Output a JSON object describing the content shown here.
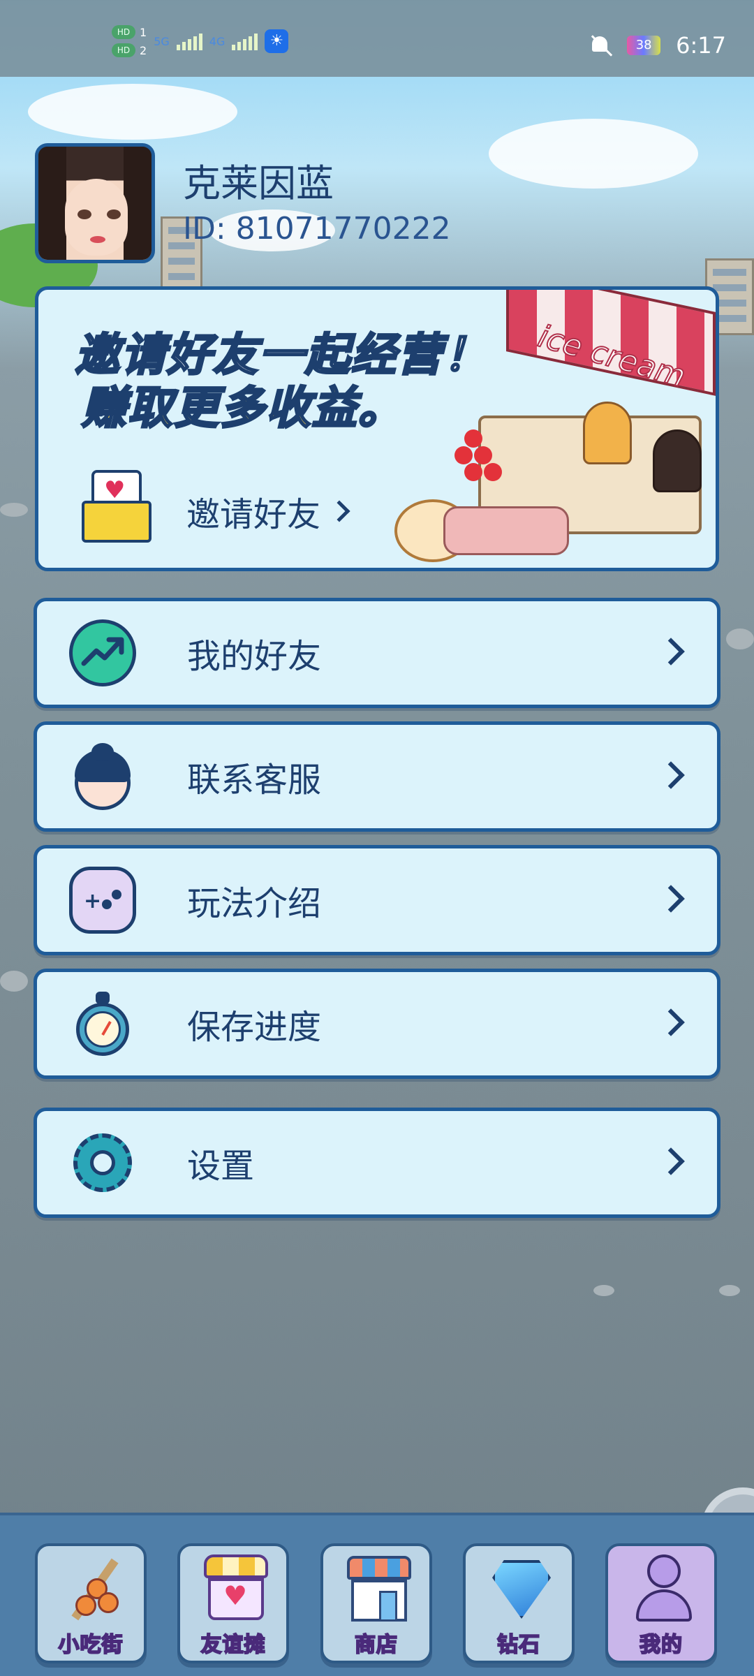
{
  "status_bar": {
    "left_badges": [
      "HD",
      "HD"
    ],
    "sim1": "1",
    "sim2": "2",
    "net1": "5G",
    "net2": "4G",
    "battery": "38",
    "time": "6:17"
  },
  "profile": {
    "name": "克莱因蓝",
    "id_text": "ID: 81071770222"
  },
  "invite_card": {
    "headline_line1": "邀请好友一起经营！",
    "headline_line2": "赚取更多收益。",
    "button_label": "邀请好友",
    "scene_sign": "ice cream"
  },
  "menu": {
    "items": [
      {
        "label": "我的好友",
        "icon": "trend-up-icon"
      },
      {
        "label": "联系客服",
        "icon": "customer-service-icon"
      },
      {
        "label": "玩法介绍",
        "icon": "gamepad-icon"
      },
      {
        "label": "保存进度",
        "icon": "stopwatch-icon"
      },
      {
        "label": "设置",
        "icon": "gear-icon"
      }
    ]
  },
  "bottom_nav": {
    "items": [
      {
        "label": "小吃街",
        "icon": "skewer-icon"
      },
      {
        "label": "友谊摊",
        "icon": "stall-heart-icon"
      },
      {
        "label": "商店",
        "icon": "shop-icon"
      },
      {
        "label": "钻石",
        "icon": "diamond-icon"
      },
      {
        "label": "我的",
        "icon": "profile-icon"
      }
    ],
    "active_index": 4
  },
  "colors": {
    "card_border": "#1f5c99",
    "card_bg": "#dcf3fb",
    "text_primary": "#1d3f6e",
    "nav_bg": "#4f7ea8",
    "headline_yellow": "#ffd54a"
  }
}
